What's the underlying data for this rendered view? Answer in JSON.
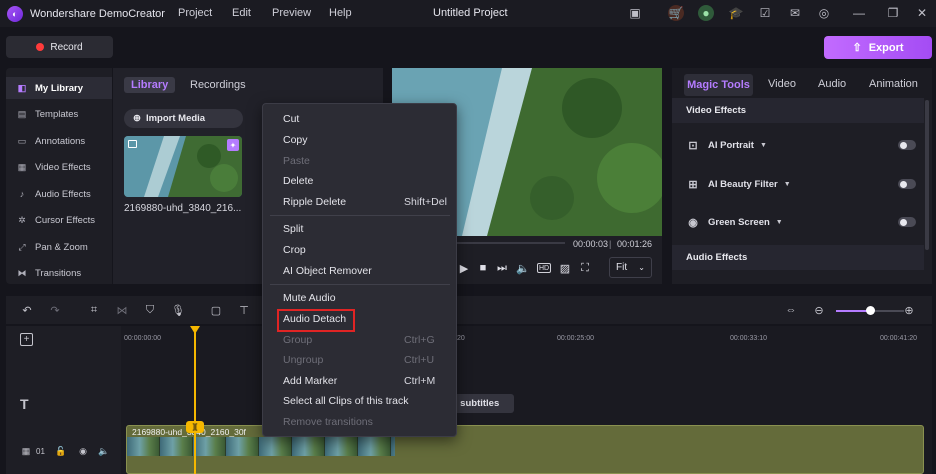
{
  "titlebar": {
    "app_title": "Wondershare DemoCreator",
    "menu": [
      "Project",
      "Edit",
      "Preview",
      "Help"
    ],
    "project_title": "Untitled Project"
  },
  "toolbar": {
    "record_label": "Record",
    "export_label": "Export"
  },
  "left_nav": {
    "items": [
      "My Library",
      "Templates",
      "Annotations",
      "Video Effects",
      "Audio Effects",
      "Cursor Effects",
      "Pan & Zoom",
      "Transitions"
    ],
    "active": "My Library"
  },
  "library": {
    "tabs": [
      "Library",
      "Recordings"
    ],
    "import_label": "Import Media",
    "media_name": "2169880-uhd_3840_216..."
  },
  "preview": {
    "time_current": "00:00:03",
    "time_total": "00:01:26",
    "fit_label": "Fit"
  },
  "right_panel": {
    "tabs": [
      "Magic Tools",
      "Video",
      "Audio",
      "Animation"
    ],
    "video_effects_title": "Video Effects",
    "effects": [
      "AI Portrait",
      "AI Beauty Filter",
      "Green Screen"
    ],
    "audio_effects_title": "Audio Effects"
  },
  "timeline": {
    "ruler": [
      "00:00:00:00",
      "20",
      "00:00:25:00",
      "00:00:33:10",
      "00:00:41:20"
    ],
    "subtitle_label": "d subtitles",
    "clip_label": "2169880-uhd_3840_2160_30f",
    "track_number": "01"
  },
  "context_menu": {
    "items": [
      {
        "label": "Cut",
        "shortcut": "",
        "disabled": false
      },
      {
        "label": "Copy",
        "shortcut": "",
        "disabled": false
      },
      {
        "label": "Paste",
        "shortcut": "",
        "disabled": true
      },
      {
        "label": "Delete",
        "shortcut": "",
        "disabled": false
      },
      {
        "label": "Ripple Delete",
        "shortcut": "Shift+Del",
        "disabled": false
      },
      {
        "label": "Split",
        "shortcut": "",
        "disabled": false
      },
      {
        "label": "Crop",
        "shortcut": "",
        "disabled": false
      },
      {
        "label": "AI Object Remover",
        "shortcut": "",
        "disabled": false
      },
      {
        "label": "Mute Audio",
        "shortcut": "",
        "disabled": false
      },
      {
        "label": "Audio Detach",
        "shortcut": "",
        "disabled": false
      },
      {
        "label": "Group",
        "shortcut": "Ctrl+G",
        "disabled": true
      },
      {
        "label": "Ungroup",
        "shortcut": "Ctrl+U",
        "disabled": true
      },
      {
        "label": "Add Marker",
        "shortcut": "Ctrl+M",
        "disabled": false
      },
      {
        "label": "Select all Clips of this track",
        "shortcut": "",
        "disabled": false
      },
      {
        "label": "Remove transitions",
        "shortcut": "",
        "disabled": true
      }
    ],
    "highlighted": "Audio Detach"
  },
  "colors": {
    "accent": "#b57cff",
    "export": "#a44cf4",
    "record": "#ff3b3b",
    "playhead": "#f5b700",
    "highlight": "#e02424"
  }
}
